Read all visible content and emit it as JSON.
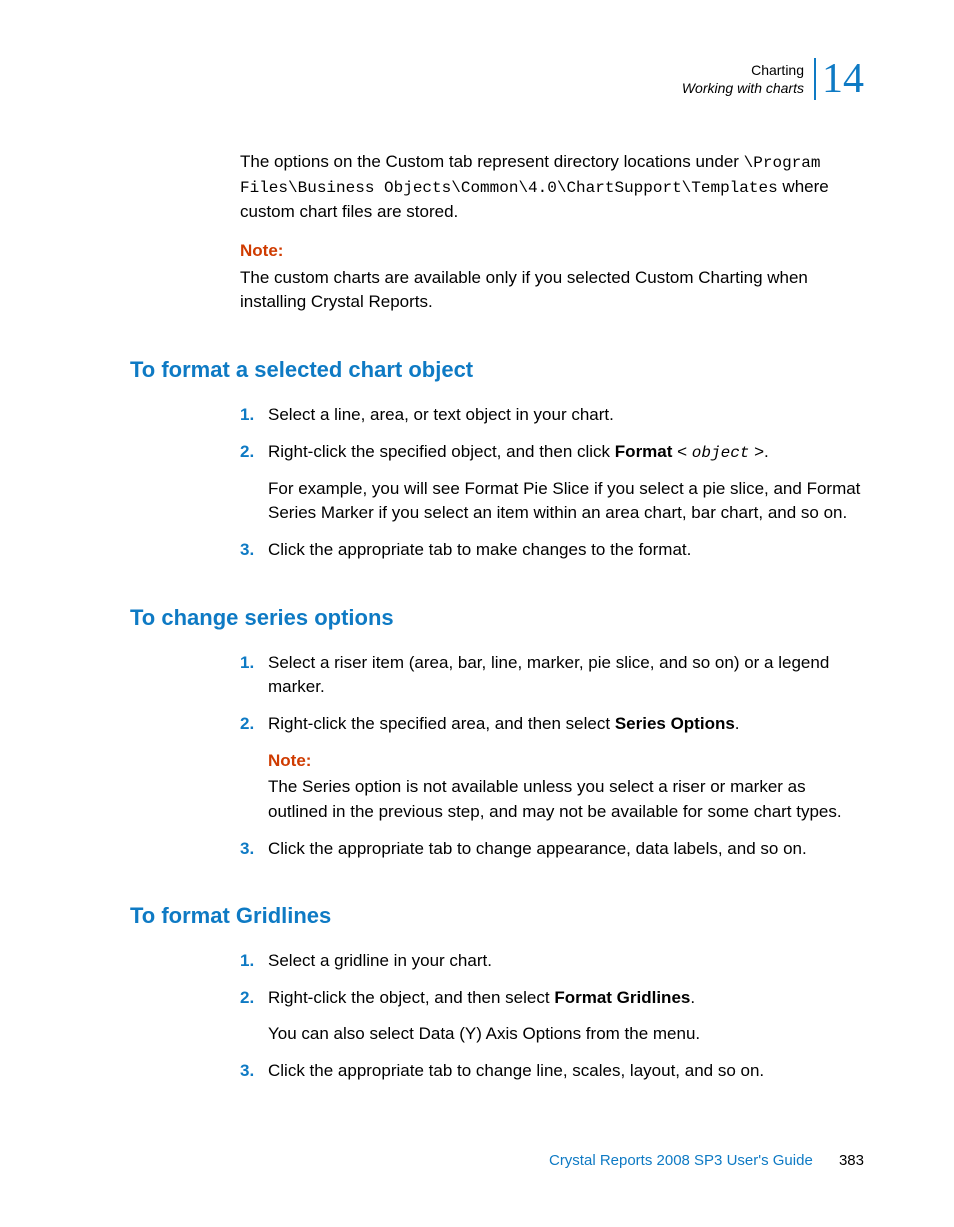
{
  "header": {
    "line1": "Charting",
    "line2": "Working with charts",
    "chapter": "14"
  },
  "intro": {
    "lead": "The options on the Custom tab represent directory locations under ",
    "path": "\\Program Files\\Business Objects\\Common\\4.0\\ChartSupport\\Templates",
    "tail": " where custom chart files are stored."
  },
  "intro_note": {
    "label": "Note:",
    "text": "The custom charts are available only if you selected Custom Charting when installing Crystal Reports."
  },
  "section1": {
    "heading": "To format a selected chart object",
    "steps": {
      "s1": {
        "num": "1.",
        "text": "Select a line, area, or text object in your chart."
      },
      "s2": {
        "num": "2.",
        "a": "Right-click the specified object, and then click ",
        "b": "Format",
        "c": " < ",
        "d": "object",
        "e": " >.",
        "sub": "For example, you will see Format Pie Slice if you select a pie slice, and Format Series Marker if you select an item within an area chart, bar chart, and so on."
      },
      "s3": {
        "num": "3.",
        "text": "Click the appropriate tab to make changes to the format."
      }
    }
  },
  "section2": {
    "heading": "To change series options",
    "steps": {
      "s1": {
        "num": "1.",
        "text": "Select a riser item (area, bar, line, marker, pie slice, and so on) or a legend marker."
      },
      "s2": {
        "num": "2.",
        "a": "Right-click the specified area, and then select ",
        "b": "Series Options",
        "c": ".",
        "note_label": "Note:",
        "note_text": "The Series option is not available unless you select a riser or marker as outlined in the previous step, and may not be available for some chart types."
      },
      "s3": {
        "num": "3.",
        "text": "Click the appropriate tab to change appearance, data labels, and so on."
      }
    }
  },
  "section3": {
    "heading": "To format Gridlines",
    "steps": {
      "s1": {
        "num": "1.",
        "text": "Select a gridline in your chart."
      },
      "s2": {
        "num": "2.",
        "a": "Right-click the object, and then select ",
        "b": "Format Gridlines",
        "c": ".",
        "sub": "You can also select Data (Y) Axis Options from the menu."
      },
      "s3": {
        "num": "3.",
        "text": "Click the appropriate tab to change line, scales, layout, and so on."
      }
    }
  },
  "footer": {
    "title": "Crystal Reports 2008 SP3 User's Guide",
    "page": "383"
  }
}
